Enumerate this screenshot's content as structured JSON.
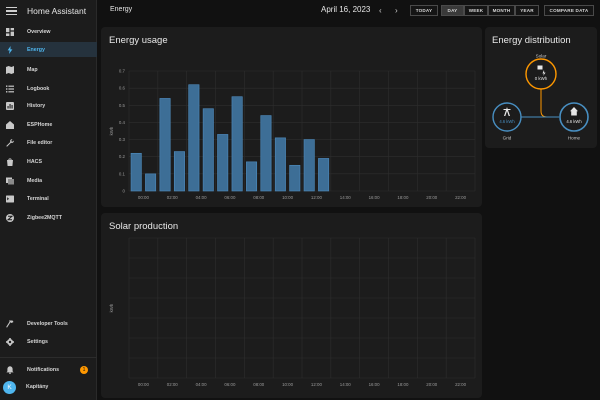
{
  "app": {
    "title": "Home Assistant"
  },
  "sidebar": {
    "items": [
      {
        "label": "Overview",
        "icon": "overview-icon"
      },
      {
        "label": "Energy",
        "icon": "energy-bolt-icon",
        "active": true
      },
      {
        "label": "Map",
        "icon": "map-icon"
      },
      {
        "label": "Logbook",
        "icon": "logbook-icon"
      },
      {
        "label": "History",
        "icon": "history-icon"
      },
      {
        "label": "ESPHome",
        "icon": "esphome-icon"
      },
      {
        "label": "File editor",
        "icon": "wrench-icon"
      },
      {
        "label": "HACS",
        "icon": "hacs-icon"
      },
      {
        "label": "Media",
        "icon": "media-icon"
      },
      {
        "label": "Terminal",
        "icon": "terminal-icon"
      },
      {
        "label": "Zigbee2MQTT",
        "icon": "zigbee-icon"
      }
    ],
    "bottom": [
      {
        "label": "Developer Tools",
        "icon": "hammer-icon"
      },
      {
        "label": "Settings",
        "icon": "gear-icon"
      }
    ],
    "notifications": {
      "label": "Notifications",
      "count": "1"
    },
    "user": {
      "initial": "K",
      "name": "Kapitány"
    }
  },
  "toolbar": {
    "page_title": "Energy",
    "date": "April 16, 2023",
    "prev_label": "‹",
    "next_label": "›",
    "today_label": "TODAY",
    "day_label": "DAY",
    "week_label": "WEEK",
    "month_label": "MONTH",
    "year_label": "YEAR",
    "compare_label": "COMPARE DATA",
    "selected_period": "DAY"
  },
  "energy_usage": {
    "title": "Energy usage",
    "chart_data": {
      "type": "bar",
      "title": "Energy usage",
      "ylabel": "kWh",
      "xlabel": "",
      "ylim": [
        0,
        0.7
      ],
      "yticks": [
        "0",
        "0.1",
        "0.2",
        "0.3",
        "0.4",
        "0.5",
        "0.6",
        "0.7"
      ],
      "xticks": [
        "00:00",
        "02:00",
        "04:00",
        "06:00",
        "08:00",
        "10:00",
        "12:00",
        "14:00",
        "16:00",
        "18:00",
        "20:00",
        "22:00"
      ],
      "hours": [
        0,
        1,
        2,
        3,
        4,
        5,
        6,
        7,
        8,
        9,
        10,
        11,
        12,
        13
      ],
      "values": [
        0.22,
        0.1,
        0.54,
        0.23,
        0.62,
        0.48,
        0.33,
        0.55,
        0.17,
        0.44,
        0.31,
        0.15,
        0.3,
        0.19
      ],
      "color": "#3d6e96"
    }
  },
  "solar_production": {
    "title": "Solar production",
    "chart_data": {
      "type": "bar",
      "title": "Solar production",
      "ylabel": "kWh",
      "xlabel": "",
      "xticks": [
        "00:00",
        "02:00",
        "04:00",
        "06:00",
        "08:00",
        "10:00",
        "12:00",
        "14:00",
        "16:00",
        "18:00",
        "20:00",
        "22:00"
      ],
      "values": []
    }
  },
  "energy_distribution": {
    "title": "Energy distribution",
    "solar": {
      "label": "Solar",
      "value": "0 kWh",
      "color": "#ff9800"
    },
    "grid": {
      "label": "Grid",
      "value": "4.6 kWh",
      "color": "#488fc2"
    },
    "home": {
      "label": "Home",
      "value": "4.6 kWh",
      "color": "#488fc2"
    }
  }
}
